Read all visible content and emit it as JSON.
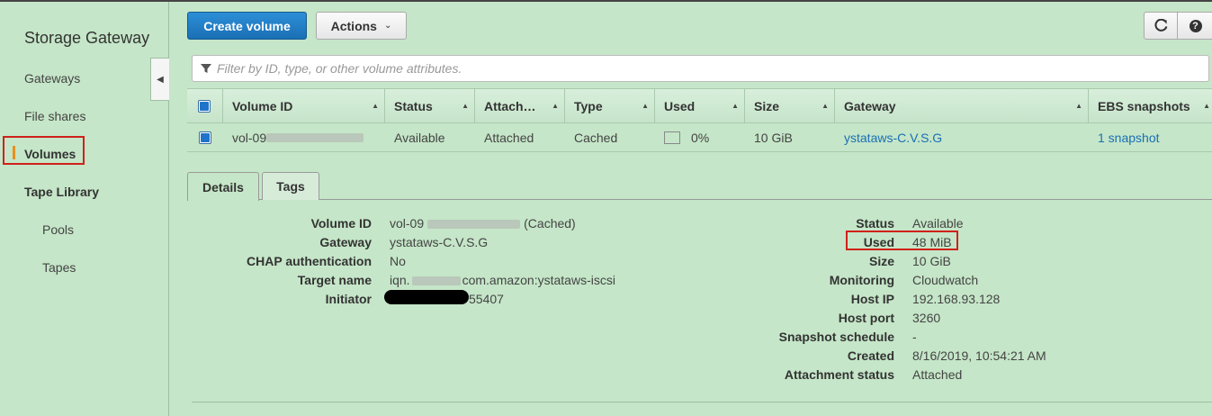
{
  "sidebar": {
    "title": "Storage Gateway",
    "items": [
      {
        "label": "Gateways"
      },
      {
        "label": "File shares"
      },
      {
        "label": "Volumes"
      },
      {
        "label": "Tape Library"
      },
      {
        "label": "Pools"
      },
      {
        "label": "Tapes"
      }
    ],
    "active": "Volumes"
  },
  "toolbar": {
    "create_label": "Create volume",
    "actions_label": "Actions",
    "refresh_icon": "refresh-icon",
    "help_icon": "help-icon"
  },
  "filter": {
    "placeholder": "Filter by ID, type, or other volume attributes."
  },
  "table": {
    "headers": [
      "Volume ID",
      "Status",
      "Attach…",
      "Type",
      "Used",
      "Size",
      "Gateway",
      "EBS snapshots"
    ],
    "rows": [
      {
        "volume_id": "vol-09",
        "status": "Available",
        "attachment": "Attached",
        "type": "Cached",
        "used": "0%",
        "size": "10 GiB",
        "gateway": "ystataws-C.V.S.G",
        "ebs_snapshots": "1 snapshot",
        "selected": true
      }
    ]
  },
  "tabs": [
    "Details",
    "Tags"
  ],
  "details": {
    "left": [
      {
        "label": "Volume ID",
        "value_prefix": "vol-09",
        "value_suffix": "(Cached)"
      },
      {
        "label": "Gateway",
        "value": "ystataws-C.V.S.G"
      },
      {
        "label": "CHAP authentication",
        "value": "No"
      },
      {
        "label": "Target name",
        "value_prefix": "iqn.",
        "value_suffix": "com.amazon:ystataws-iscsi"
      },
      {
        "label": "Initiator",
        "value_suffix": "55407"
      }
    ],
    "right": [
      {
        "label": "Status",
        "value": "Available"
      },
      {
        "label": "Used",
        "value": "48 MiB"
      },
      {
        "label": "Size",
        "value": "10 GiB"
      },
      {
        "label": "Monitoring",
        "value": "Cloudwatch"
      },
      {
        "label": "Host IP",
        "value": "192.168.93.128"
      },
      {
        "label": "Host port",
        "value": "3260"
      },
      {
        "label": "Snapshot schedule",
        "value": "-"
      },
      {
        "label": "Created",
        "value": "8/16/2019, 10:54:21 AM"
      },
      {
        "label": "Attachment status",
        "value": "Attached"
      }
    ]
  },
  "colors": {
    "background": "#c5e6c8",
    "primary": "#1a6fb5",
    "link": "#1a6fb5",
    "highlight": "#d0211a",
    "active_bar": "#e8901e"
  }
}
